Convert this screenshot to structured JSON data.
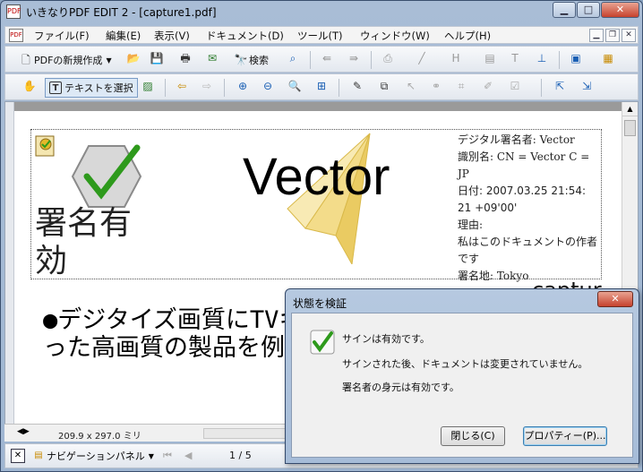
{
  "window": {
    "title": "いきなりPDF EDIT 2 - [capture1.pdf]",
    "minimize": "▁",
    "maximize": "□",
    "close": "✕"
  },
  "menu": [
    "ファイル(F)",
    "編集(E)",
    "表示(V)",
    "ドキュメント(D)",
    "ツール(T)",
    "ウィンドウ(W)",
    "ヘルプ(H)"
  ],
  "toolbar1": {
    "new_pdf": "PDFの新規作成",
    "search": "検索"
  },
  "toolbar2": {
    "select_text": "テキストを選択"
  },
  "document": {
    "signature": {
      "status_text": "署名有効",
      "signer_label": "デジタル署名者: Vector",
      "dn_label": "識別名: CN = Vector C = JP",
      "date_label": "日付: 2007.03.25 21:54: 21 +09'00'",
      "reason_label": "理由:",
      "reason_value": "私はこのドキュメントの作者です",
      "location_label": "署名地: Tokyo",
      "logo_text": "Vector"
    },
    "body_text": "●デジタイズ画質にTVキャプチャ製品のDNRといった高画質の製品を例にとって",
    "capture_text": "captur"
  },
  "statusbar": {
    "page_size": "209.9 x 297.0 ミリ"
  },
  "bottombar": {
    "nav_panel": "ナビゲーションパネル",
    "page_indicator": "1 / 5"
  },
  "dialog": {
    "title": "状態を検証",
    "msg1": "サインは有効です。",
    "msg2": "サインされた後、ドキュメントは変更されていません。",
    "msg3": "署名者の身元は有効です。",
    "close_button": "閉じる(C)",
    "properties_button": "プロパティー(P)..."
  },
  "colors": {
    "check_green": "#2e9a1c",
    "title_bg": "#a9bdd6"
  }
}
